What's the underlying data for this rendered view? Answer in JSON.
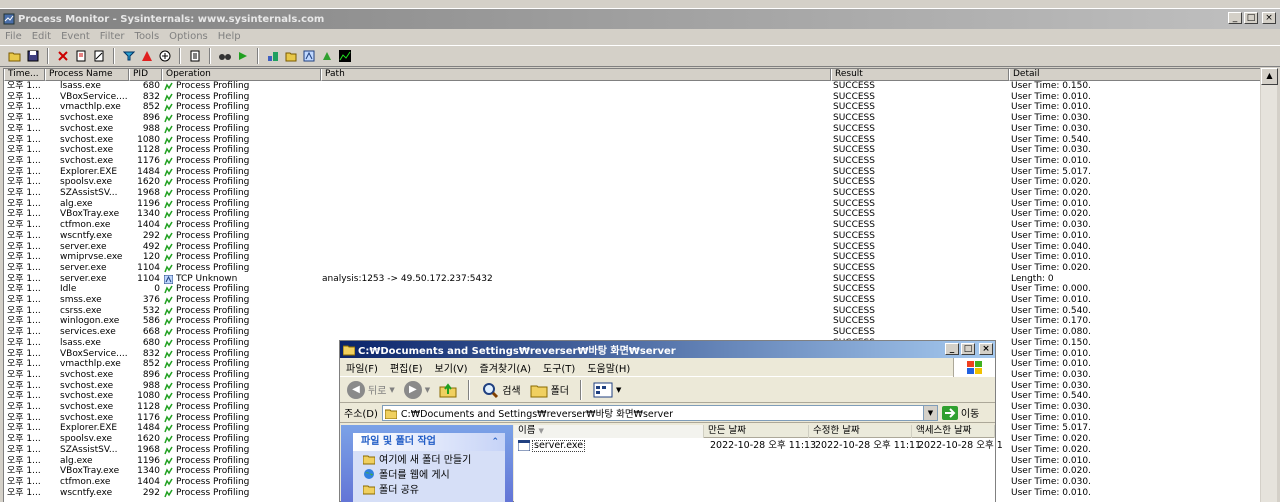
{
  "procmon": {
    "title": "Process Monitor - Sysinternals: www.sysinternals.com",
    "menu": [
      "File",
      "Edit",
      "Event",
      "Filter",
      "Tools",
      "Options",
      "Help"
    ],
    "columns": [
      "Time...",
      "Process Name",
      "PID",
      "Operation",
      "Path",
      "Result",
      "Detail"
    ],
    "rows": [
      {
        "time": "오후 1...",
        "process": "lsass.exe",
        "pid": "680",
        "operation": "Process Profiling",
        "path": "",
        "result": "SUCCESS",
        "detail": "User Time: 0.150..."
      },
      {
        "time": "오후 1...",
        "process": "VBoxService....",
        "pid": "832",
        "operation": "Process Profiling",
        "path": "",
        "result": "SUCCESS",
        "detail": "User Time: 0.010..."
      },
      {
        "time": "오후 1...",
        "process": "vmacthlp.exe",
        "pid": "852",
        "operation": "Process Profiling",
        "path": "",
        "result": "SUCCESS",
        "detail": "User Time: 0.010..."
      },
      {
        "time": "오후 1...",
        "process": "svchost.exe",
        "pid": "896",
        "operation": "Process Profiling",
        "path": "",
        "result": "SUCCESS",
        "detail": "User Time: 0.030..."
      },
      {
        "time": "오후 1...",
        "process": "svchost.exe",
        "pid": "988",
        "operation": "Process Profiling",
        "path": "",
        "result": "SUCCESS",
        "detail": "User Time: 0.030..."
      },
      {
        "time": "오후 1...",
        "process": "svchost.exe",
        "pid": "1080",
        "operation": "Process Profiling",
        "path": "",
        "result": "SUCCESS",
        "detail": "User Time: 0.540..."
      },
      {
        "time": "오후 1...",
        "process": "svchost.exe",
        "pid": "1128",
        "operation": "Process Profiling",
        "path": "",
        "result": "SUCCESS",
        "detail": "User Time: 0.030..."
      },
      {
        "time": "오후 1...",
        "process": "svchost.exe",
        "pid": "1176",
        "operation": "Process Profiling",
        "path": "",
        "result": "SUCCESS",
        "detail": "User Time: 0.010..."
      },
      {
        "time": "오후 1...",
        "process": "Explorer.EXE",
        "pid": "1484",
        "operation": "Process Profiling",
        "path": "",
        "result": "SUCCESS",
        "detail": "User Time: 5.017..."
      },
      {
        "time": "오후 1...",
        "process": "spoolsv.exe",
        "pid": "1620",
        "operation": "Process Profiling",
        "path": "",
        "result": "SUCCESS",
        "detail": "User Time: 0.020..."
      },
      {
        "time": "오후 1...",
        "process": "SZAssistSV...",
        "pid": "1968",
        "operation": "Process Profiling",
        "path": "",
        "result": "SUCCESS",
        "detail": "User Time: 0.020..."
      },
      {
        "time": "오후 1...",
        "process": "alg.exe",
        "pid": "1196",
        "operation": "Process Profiling",
        "path": "",
        "result": "SUCCESS",
        "detail": "User Time: 0.010..."
      },
      {
        "time": "오후 1...",
        "process": "VBoxTray.exe",
        "pid": "1340",
        "operation": "Process Profiling",
        "path": "",
        "result": "SUCCESS",
        "detail": "User Time: 0.020..."
      },
      {
        "time": "오후 1...",
        "process": "ctfmon.exe",
        "pid": "1404",
        "operation": "Process Profiling",
        "path": "",
        "result": "SUCCESS",
        "detail": "User Time: 0.030..."
      },
      {
        "time": "오후 1...",
        "process": "wscntfy.exe",
        "pid": "292",
        "operation": "Process Profiling",
        "path": "",
        "result": "SUCCESS",
        "detail": "User Time: 0.010..."
      },
      {
        "time": "오후 1...",
        "process": "server.exe",
        "pid": "492",
        "operation": "Process Profiling",
        "path": "",
        "result": "SUCCESS",
        "detail": "User Time: 0.040..."
      },
      {
        "time": "오후 1...",
        "process": "wmiprvse.exe",
        "pid": "120",
        "operation": "Process Profiling",
        "path": "",
        "result": "SUCCESS",
        "detail": "User Time: 0.010..."
      },
      {
        "time": "오후 1...",
        "process": "server.exe",
        "pid": "1104",
        "operation": "Process Profiling",
        "path": "",
        "result": "SUCCESS",
        "detail": "User Time: 0.020..."
      },
      {
        "time": "오후 1...",
        "process": "server.exe",
        "pid": "1104",
        "operation": "TCP Unknown",
        "path": "analysis:1253 -> 49.50.172.237:5432",
        "result": "SUCCESS",
        "detail": "Length: 0"
      },
      {
        "time": "오후 1...",
        "process": "Idle",
        "pid": "0",
        "operation": "Process Profiling",
        "path": "",
        "result": "SUCCESS",
        "detail": "User Time: 0.000..."
      },
      {
        "time": "오후 1...",
        "process": "smss.exe",
        "pid": "376",
        "operation": "Process Profiling",
        "path": "",
        "result": "SUCCESS",
        "detail": "User Time: 0.010..."
      },
      {
        "time": "오후 1...",
        "process": "csrss.exe",
        "pid": "532",
        "operation": "Process Profiling",
        "path": "",
        "result": "SUCCESS",
        "detail": "User Time: 0.540..."
      },
      {
        "time": "오후 1...",
        "process": "winlogon.exe",
        "pid": "586",
        "operation": "Process Profiling",
        "path": "",
        "result": "SUCCESS",
        "detail": "User Time: 0.170..."
      },
      {
        "time": "오후 1...",
        "process": "services.exe",
        "pid": "668",
        "operation": "Process Profiling",
        "path": "",
        "result": "SUCCESS",
        "detail": "User Time: 0.080..."
      },
      {
        "time": "오후 1...",
        "process": "lsass.exe",
        "pid": "680",
        "operation": "Process Profiling",
        "path": "",
        "result": "SUCCESS",
        "detail": "User Time: 0.150..."
      },
      {
        "time": "오후 1...",
        "process": "VBoxService....",
        "pid": "832",
        "operation": "Process Profiling",
        "path": "",
        "result": "SUCCESS",
        "detail": "User Time: 0.010..."
      },
      {
        "time": "오후 1...",
        "process": "vmacthlp.exe",
        "pid": "852",
        "operation": "Process Profiling",
        "path": "",
        "result": "SUCCESS",
        "detail": "User Time: 0.010..."
      },
      {
        "time": "오후 1...",
        "process": "svchost.exe",
        "pid": "896",
        "operation": "Process Profiling",
        "path": "",
        "result": "SUCCESS",
        "detail": "User Time: 0.030..."
      },
      {
        "time": "오후 1...",
        "process": "svchost.exe",
        "pid": "988",
        "operation": "Process Profiling",
        "path": "",
        "result": "SUCCESS",
        "detail": "User Time: 0.030..."
      },
      {
        "time": "오후 1...",
        "process": "svchost.exe",
        "pid": "1080",
        "operation": "Process Profiling",
        "path": "",
        "result": "SUCCESS",
        "detail": "User Time: 0.540..."
      },
      {
        "time": "오후 1...",
        "process": "svchost.exe",
        "pid": "1128",
        "operation": "Process Profiling",
        "path": "",
        "result": "SUCCESS",
        "detail": "User Time: 0.030..."
      },
      {
        "time": "오후 1...",
        "process": "svchost.exe",
        "pid": "1176",
        "operation": "Process Profiling",
        "path": "",
        "result": "SUCCESS",
        "detail": "User Time: 0.010..."
      },
      {
        "time": "오후 1...",
        "process": "Explorer.EXE",
        "pid": "1484",
        "operation": "Process Profiling",
        "path": "",
        "result": "SUCCESS",
        "detail": "User Time: 5.017..."
      },
      {
        "time": "오후 1...",
        "process": "spoolsv.exe",
        "pid": "1620",
        "operation": "Process Profiling",
        "path": "",
        "result": "SUCCESS",
        "detail": "User Time: 0.020..."
      },
      {
        "time": "오후 1...",
        "process": "SZAssistSV...",
        "pid": "1968",
        "operation": "Process Profiling",
        "path": "",
        "result": "SUCCESS",
        "detail": "User Time: 0.020..."
      },
      {
        "time": "오후 1...",
        "process": "alg.exe",
        "pid": "1196",
        "operation": "Process Profiling",
        "path": "",
        "result": "SUCCESS",
        "detail": "User Time: 0.010..."
      },
      {
        "time": "오후 1...",
        "process": "VBoxTray.exe",
        "pid": "1340",
        "operation": "Process Profiling",
        "path": "",
        "result": "SUCCESS",
        "detail": "User Time: 0.020..."
      },
      {
        "time": "오후 1...",
        "process": "ctfmon.exe",
        "pid": "1404",
        "operation": "Process Profiling",
        "path": "",
        "result": "SUCCESS",
        "detail": "User Time: 0.030..."
      },
      {
        "time": "오후 1...",
        "process": "wscntfy.exe",
        "pid": "292",
        "operation": "Process Profiling",
        "path": "",
        "result": "SUCCESS",
        "detail": "User Time: 0.010..."
      }
    ]
  },
  "explorer": {
    "title": "C:₩Documents and Settings₩reverser₩바탕 화면₩server",
    "menu": [
      "파일(F)",
      "편집(E)",
      "보기(V)",
      "즐겨찾기(A)",
      "도구(T)",
      "도움말(H)"
    ],
    "toolbar": {
      "back": "뒤로",
      "search": "검색",
      "folders": "폴더"
    },
    "address_label": "주소(D)",
    "address": "C:₩Documents and Settings₩reverser₩바탕 화면₩server",
    "go": "이동",
    "task_panel_title": "파일 및 폴더 작업",
    "tasks": [
      "여기에 새 폴더 만들기",
      "폴더를 웹에 게시",
      "폴더 공유"
    ],
    "columns": [
      "이름",
      "만든 날짜",
      "수정한 날짜",
      "액세스한 날짜"
    ],
    "file": {
      "name": "server.exe",
      "created": "2022-10-28 오후 11:13",
      "modified": "2022-10-28 오후 11:11",
      "accessed": "2022-10-28 오후 1"
    }
  },
  "colors": {
    "title_active": "#0a246a",
    "title_inactive": "#808080",
    "window_face": "#d4d0c8",
    "link": "#215dc6"
  }
}
